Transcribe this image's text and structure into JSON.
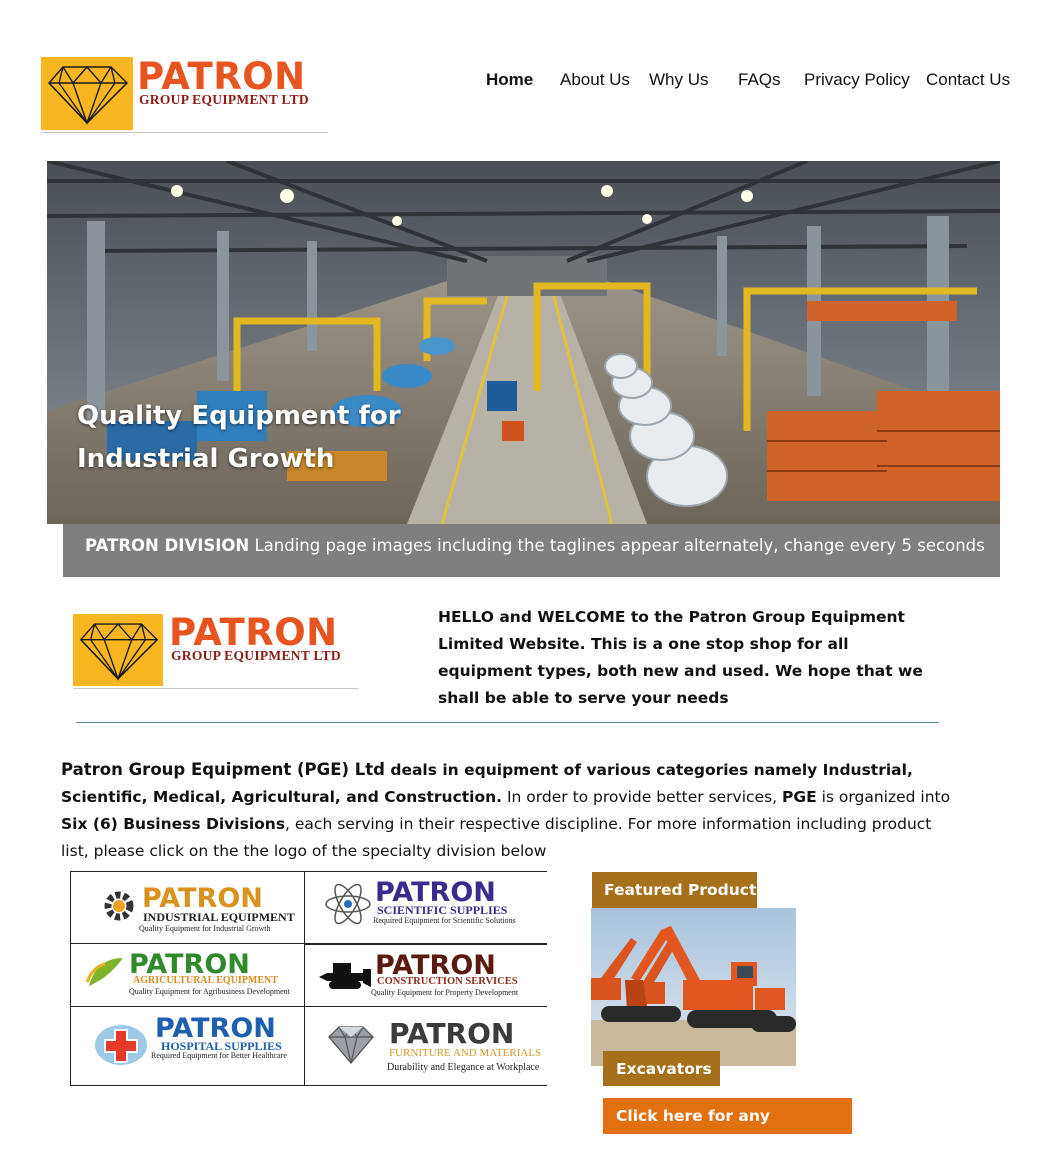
{
  "brand": {
    "name": "PATRON",
    "subtitle": "GROUP EQUIPMENT LTD"
  },
  "nav": {
    "items": [
      {
        "label": "Home",
        "active": true
      },
      {
        "label": "About Us"
      },
      {
        "label": "Why Us"
      },
      {
        "label": "FAQs"
      },
      {
        "label": "Privacy Policy"
      },
      {
        "label": "Contact Us"
      }
    ]
  },
  "hero": {
    "tagline_line1": "Quality Equipment for",
    "tagline_line2": "Industrial Growth",
    "caption_bold": "PATRON DIVISION",
    "caption_text": " Landing page images including the taglines appear alternately, change every 5 seconds"
  },
  "welcome": {
    "text": "HELLO and WELCOME to the Patron Group Equipment Limited Website. This is a one stop shop for all equipment types, both new and used. We hope that we shall be able to serve your needs"
  },
  "intro": {
    "bold_lead": "Patron Group Equipment (PGE) Ltd",
    "bold_rest": " deals in equipment of various categories namely Industrial, Scientific, Medical, Agricultural, and Construction.",
    "text1": " In order to provide better services, ",
    "pge": "PGE",
    "text2": " is organized into ",
    "six": "Six (6) Business Divisions",
    "text3": ", each serving in their respective discipline. For more information including product list, please click on the the logo of the specialty division below"
  },
  "divisions": [
    {
      "brand": "PATRON",
      "sub": "INDUSTRIAL EQUIPMENT",
      "tag": "Quality Equipment for Industrial Growth",
      "icon": "gear-icon"
    },
    {
      "brand": "PATRON",
      "sub": "SCIENTIFIC SUPPLIES",
      "tag": "Required Equipment for Scientific Solutions",
      "icon": "atom-icon"
    },
    {
      "brand": "PATRON",
      "sub": "AGRICULTURAL EQUIPMENT",
      "tag": "Quality Equipment for Agribusiness Development",
      "icon": "leaf-icon"
    },
    {
      "brand": "PATRON",
      "sub": "CONSTRUCTION SERVICES",
      "tag": "Quality Equipment for Property Development",
      "icon": "bulldozer-icon"
    },
    {
      "brand": "PATRON",
      "sub": "HOSPITAL SUPPLIES",
      "tag": "Required Equipment for Better Healthcare",
      "icon": "medical-cross-icon"
    },
    {
      "brand": "PATRON",
      "sub": "FURNITURE AND MATERIALS",
      "tag": "Durability and Elegance at Workplace",
      "icon": "diamond-icon"
    }
  ],
  "featured": {
    "label": "Featured Product",
    "product": "Excavators"
  },
  "enquiry": {
    "label": "Click here for any enquiries"
  },
  "colors": {
    "brand_orange": "#e8541f",
    "brand_gold": "#f8b621",
    "featured_brown": "#a66f1c",
    "enquiry_orange": "#e3700e",
    "caption_gray": "#7f7f7f"
  }
}
